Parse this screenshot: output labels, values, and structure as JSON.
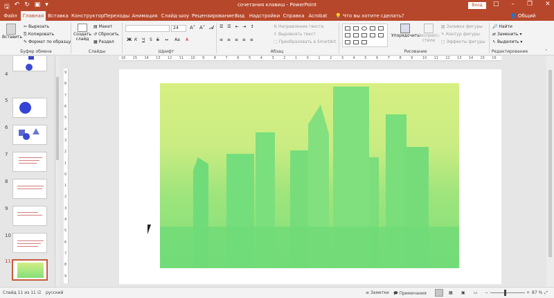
{
  "titlebar": {
    "document_title": "сочетания клавиш - PowerPoint",
    "signin": "Вход",
    "qat_icons": [
      "save-icon",
      "undo-icon",
      "redo-icon",
      "start-presentation-icon",
      "customize-icon"
    ]
  },
  "tabs": [
    "Файл",
    "Главная",
    "Вставка",
    "Конструктор",
    "Переходы",
    "Анимация",
    "Слайд-шоу",
    "Рецензирование",
    "Вид",
    "Надстройки",
    "Справка",
    "Acrobat"
  ],
  "active_tab": "Главная",
  "tell_me": "Что вы хотите сделать?",
  "share": "Общий доступ",
  "ribbon": {
    "clipboard": {
      "paste": "Вставить",
      "cut": "Вырезать",
      "copy": "Копировать",
      "format_painter": "Формат по образцу",
      "label": "Буфер обмена"
    },
    "slides": {
      "new_slide": "Создать слайд",
      "layout": "Макет",
      "reset": "Сбросить",
      "section": "Раздел",
      "label": "Слайды"
    },
    "font": {
      "font_name": "",
      "font_size": "24",
      "bold": "Ж",
      "italic": "К",
      "underline": "Ч",
      "strike": "S",
      "shadow": "abc",
      "label": "Шрифт"
    },
    "paragraph": {
      "text_direction": "Направление текста",
      "align_text": "Выровнять текст",
      "smartart": "Преобразовать в SmartArt",
      "label": "Абзац"
    },
    "drawing": {
      "arrange": "Упорядочить",
      "quick_styles": "Экспресс-стили",
      "fill": "Заливка фигуры",
      "outline": "Контур фигуры",
      "effects": "Эффекты фигуры",
      "label": "Рисование"
    },
    "editing": {
      "find": "Найти",
      "replace": "Заменить",
      "select": "Выделить",
      "label": "Редактирование"
    }
  },
  "thumbnails": [
    {
      "num": "4"
    },
    {
      "num": "5"
    },
    {
      "num": "6"
    },
    {
      "num": "7"
    },
    {
      "num": "8"
    },
    {
      "num": "9"
    },
    {
      "num": "10"
    },
    {
      "num": "11"
    }
  ],
  "ruler_top_labels": [
    "16",
    "15",
    "14",
    "13",
    "12",
    "11",
    "10",
    "9",
    "8",
    "7",
    "6",
    "5",
    "4",
    "3",
    "2",
    "1",
    "0",
    "1",
    "2",
    "3",
    "4",
    "5",
    "6",
    "7",
    "8",
    "9",
    "10",
    "11",
    "12",
    "13",
    "14",
    "15",
    "16"
  ],
  "ruler_left_labels": [
    "9",
    "8",
    "7",
    "6",
    "5",
    "4",
    "3",
    "2",
    "1",
    "0",
    "1",
    "2",
    "3",
    "4",
    "5",
    "6",
    "7",
    "8",
    "9"
  ],
  "status": {
    "slide_info": "Слайд 11 из 11",
    "language": "русский",
    "notes": "Заметки",
    "comments": "Примечания",
    "zoom": "87 %"
  },
  "colors": {
    "accent": "#b7472a",
    "photo_top": "#d7ef83",
    "photo_bottom": "#7ee07a"
  }
}
